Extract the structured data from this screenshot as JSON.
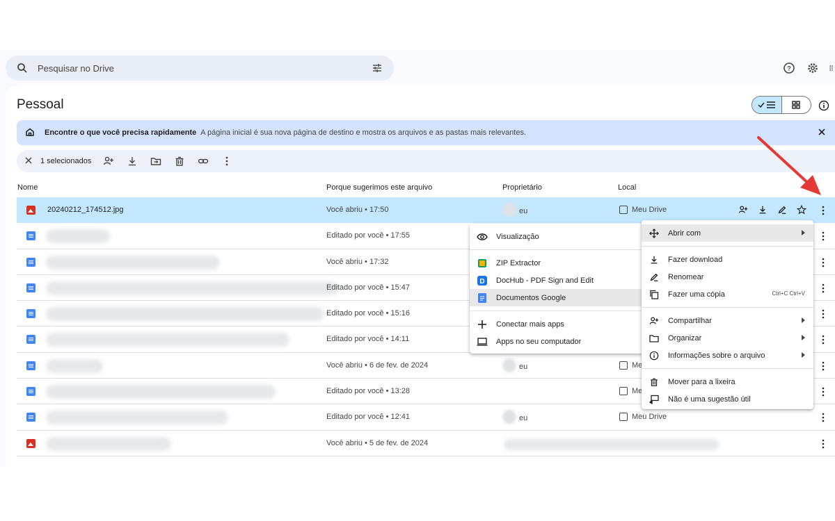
{
  "search": {
    "placeholder": "Pesquisar no Drive"
  },
  "page": {
    "title": "Pessoal"
  },
  "banner": {
    "heading": "Encontre o que você precisa rapidamente",
    "text": "A página inicial é sua nova página de destino e mostra os arquivos e as pastas mais relevantes."
  },
  "selection_bar": {
    "count_label": "1 selecionados"
  },
  "table": {
    "headers": {
      "name": "Nome",
      "reason": "Porque sugerimos este arquivo",
      "owner": "Proprietário",
      "location": "Local"
    },
    "rows": [
      {
        "name": "20240212_174512.jpg",
        "reason": "Você abriu • 17:50",
        "owner": "eu",
        "location": "Meu Drive"
      },
      {
        "name": "",
        "reason": "Editado por você • 17:55",
        "owner": "",
        "location": ""
      },
      {
        "name": "",
        "reason": "Você abriu • 17:32",
        "owner": "",
        "location": ""
      },
      {
        "name": "",
        "reason": "Editado por você • 15:47",
        "owner": "",
        "location": ""
      },
      {
        "name": "",
        "reason": "Editado por você • 15:16",
        "owner": "",
        "location": ""
      },
      {
        "name": "",
        "reason": "Editado por você • 14:11",
        "owner": "",
        "location": ""
      },
      {
        "name": "",
        "reason": "Você abriu • 6 de fev. de 2024",
        "owner": "eu",
        "location": "Me"
      },
      {
        "name": "",
        "reason": "Editado por você • 13:28",
        "owner": "",
        "location": "Me"
      },
      {
        "name": "",
        "reason": "Editado por você • 12:41",
        "owner": "eu",
        "location": "Meu Drive"
      },
      {
        "name": "",
        "reason": "Você abriu • 5 de fev. de 2024",
        "owner": "",
        "location": ""
      }
    ]
  },
  "open_with_menu": {
    "preview": "Visualização",
    "apps": [
      "ZIP Extractor",
      "DocHub - PDF Sign and Edit",
      "Documentos Google"
    ],
    "connect": "Conectar mais apps",
    "computer_apps": "Apps no seu computador"
  },
  "context_menu": {
    "open_with": "Abrir com",
    "download": "Fazer download",
    "rename": "Renomear",
    "make_copy": "Fazer uma cópia",
    "copy_shortcut": "Ctrl+C Ctrl+V",
    "share": "Compartilhar",
    "organize": "Organizar",
    "file_info": "Informações sobre o arquivo",
    "trash": "Mover para a lixeira",
    "not_useful": "Não é uma sugestão útil"
  },
  "colors": {
    "accent": "#c2e7ff",
    "banner": "#d3e3fd",
    "annotation": "#e53935"
  }
}
